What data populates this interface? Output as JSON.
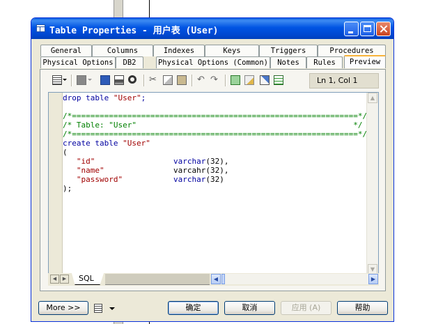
{
  "window": {
    "title": "Table Properties - 用户表 (User)"
  },
  "tabs": {
    "row1": [
      "General",
      "Columns",
      "Indexes",
      "Keys",
      "Triggers",
      "Procedures"
    ],
    "row2": [
      "Physical Options",
      "DB2",
      "Physical Options (Common)",
      "Notes",
      "Rules",
      "Preview"
    ],
    "active": "Preview"
  },
  "toolbar": {
    "position_label": "Ln 1, Col 1",
    "icons": [
      "properties-icon",
      "dropdown-arrow-icon",
      "gray-square-icon",
      "save-icon",
      "print-icon",
      "find-icon",
      "cut-icon",
      "copy-icon",
      "paste-icon",
      "undo-icon",
      "redo-icon",
      "refresh-icon",
      "edit-icon",
      "edit-template-icon",
      "checklist-icon"
    ]
  },
  "editor": {
    "lines": [
      [
        {
          "t": "drop table ",
          "c": "kw"
        },
        {
          "t": "\"User\"",
          "c": "str"
        },
        {
          "t": ";",
          "c": "kw"
        }
      ],
      [],
      [
        {
          "t": "/*==============================================================*/",
          "c": "cm"
        }
      ],
      [
        {
          "t": "/* Table: \"User\"                                               */",
          "c": "cm"
        }
      ],
      [
        {
          "t": "/*==============================================================*/",
          "c": "cm"
        }
      ],
      [
        {
          "t": "create table ",
          "c": "kw"
        },
        {
          "t": "\"User\"",
          "c": "str"
        }
      ],
      [
        {
          "t": "(",
          "c": ""
        }
      ],
      [
        {
          "t": "   ",
          "c": ""
        },
        {
          "t": "\"id\"",
          "c": "str"
        },
        {
          "t": "                 ",
          "c": ""
        },
        {
          "t": "varchar",
          "c": "kw"
        },
        {
          "t": "(32),",
          "c": ""
        }
      ],
      [
        {
          "t": "   ",
          "c": ""
        },
        {
          "t": "\"name\"",
          "c": "str"
        },
        {
          "t": "               ",
          "c": ""
        },
        {
          "t": "varcahr",
          "c": ""
        },
        {
          "t": "(32),",
          "c": ""
        }
      ],
      [
        {
          "t": "   ",
          "c": ""
        },
        {
          "t": "\"password\"",
          "c": "str"
        },
        {
          "t": "           ",
          "c": ""
        },
        {
          "t": "varchar",
          "c": "kw"
        },
        {
          "t": "(32)",
          "c": ""
        }
      ],
      [
        {
          "t": ");",
          "c": ""
        }
      ]
    ],
    "sheet_tab": "SQL"
  },
  "buttons": {
    "more": "More >>",
    "ok": "确定",
    "cancel": "取消",
    "apply": "应用 (A)",
    "help": "帮助"
  }
}
